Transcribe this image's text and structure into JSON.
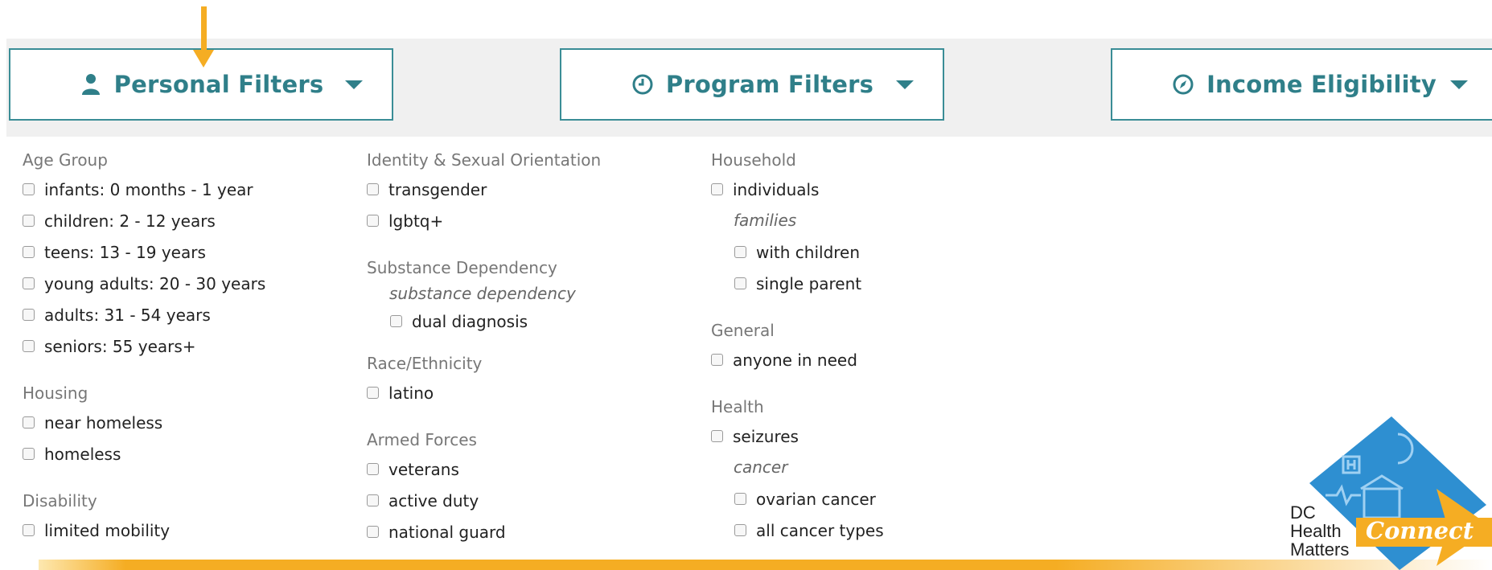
{
  "tabs": [
    {
      "label": "Personal Filters",
      "icon": "person-icon"
    },
    {
      "label": "Program Filters",
      "icon": "clock-icon"
    },
    {
      "label": "Income Eligibility",
      "icon": "compass-icon"
    }
  ],
  "columns": {
    "col1": {
      "age_group": {
        "heading": "Age Group",
        "options": [
          "infants: 0 months - 1 year",
          "children: 2 - 12 years",
          "teens: 13 - 19 years",
          "young adults: 20 - 30 years",
          "adults: 31 - 54 years",
          "seniors: 55 years+"
        ]
      },
      "housing": {
        "heading": "Housing",
        "options": [
          "near homeless",
          "homeless"
        ]
      },
      "disability": {
        "heading": "Disability",
        "options": [
          "limited mobility"
        ]
      }
    },
    "col2": {
      "identity": {
        "heading": "Identity & Sexual Orientation",
        "options": [
          "transgender",
          "lgbtq+"
        ]
      },
      "substance": {
        "heading": "Substance Dependency",
        "subheading": "substance dependency",
        "options": [
          "dual diagnosis"
        ]
      },
      "race": {
        "heading": "Race/Ethnicity",
        "options": [
          "latino"
        ]
      },
      "armed": {
        "heading": "Armed Forces",
        "options": [
          "veterans",
          "active duty",
          "national guard"
        ]
      }
    },
    "col3": {
      "household": {
        "heading": "Household",
        "options": [
          "individuals"
        ],
        "subheading": "families",
        "sub_options": [
          "with children",
          "single parent"
        ]
      },
      "general": {
        "heading": "General",
        "options": [
          "anyone in need"
        ]
      },
      "health": {
        "heading": "Health",
        "options": [
          "seizures"
        ],
        "subheading": "cancer",
        "sub_options": [
          "ovarian cancer",
          "all cancer types"
        ]
      }
    }
  },
  "logo": {
    "line1": "DC",
    "line2": "Health",
    "line3": "Matters",
    "connect": "Connect"
  },
  "colors": {
    "accent": "#3a8d96",
    "arrow": "#f5ad23",
    "logo_blue": "#2e8fd1"
  }
}
